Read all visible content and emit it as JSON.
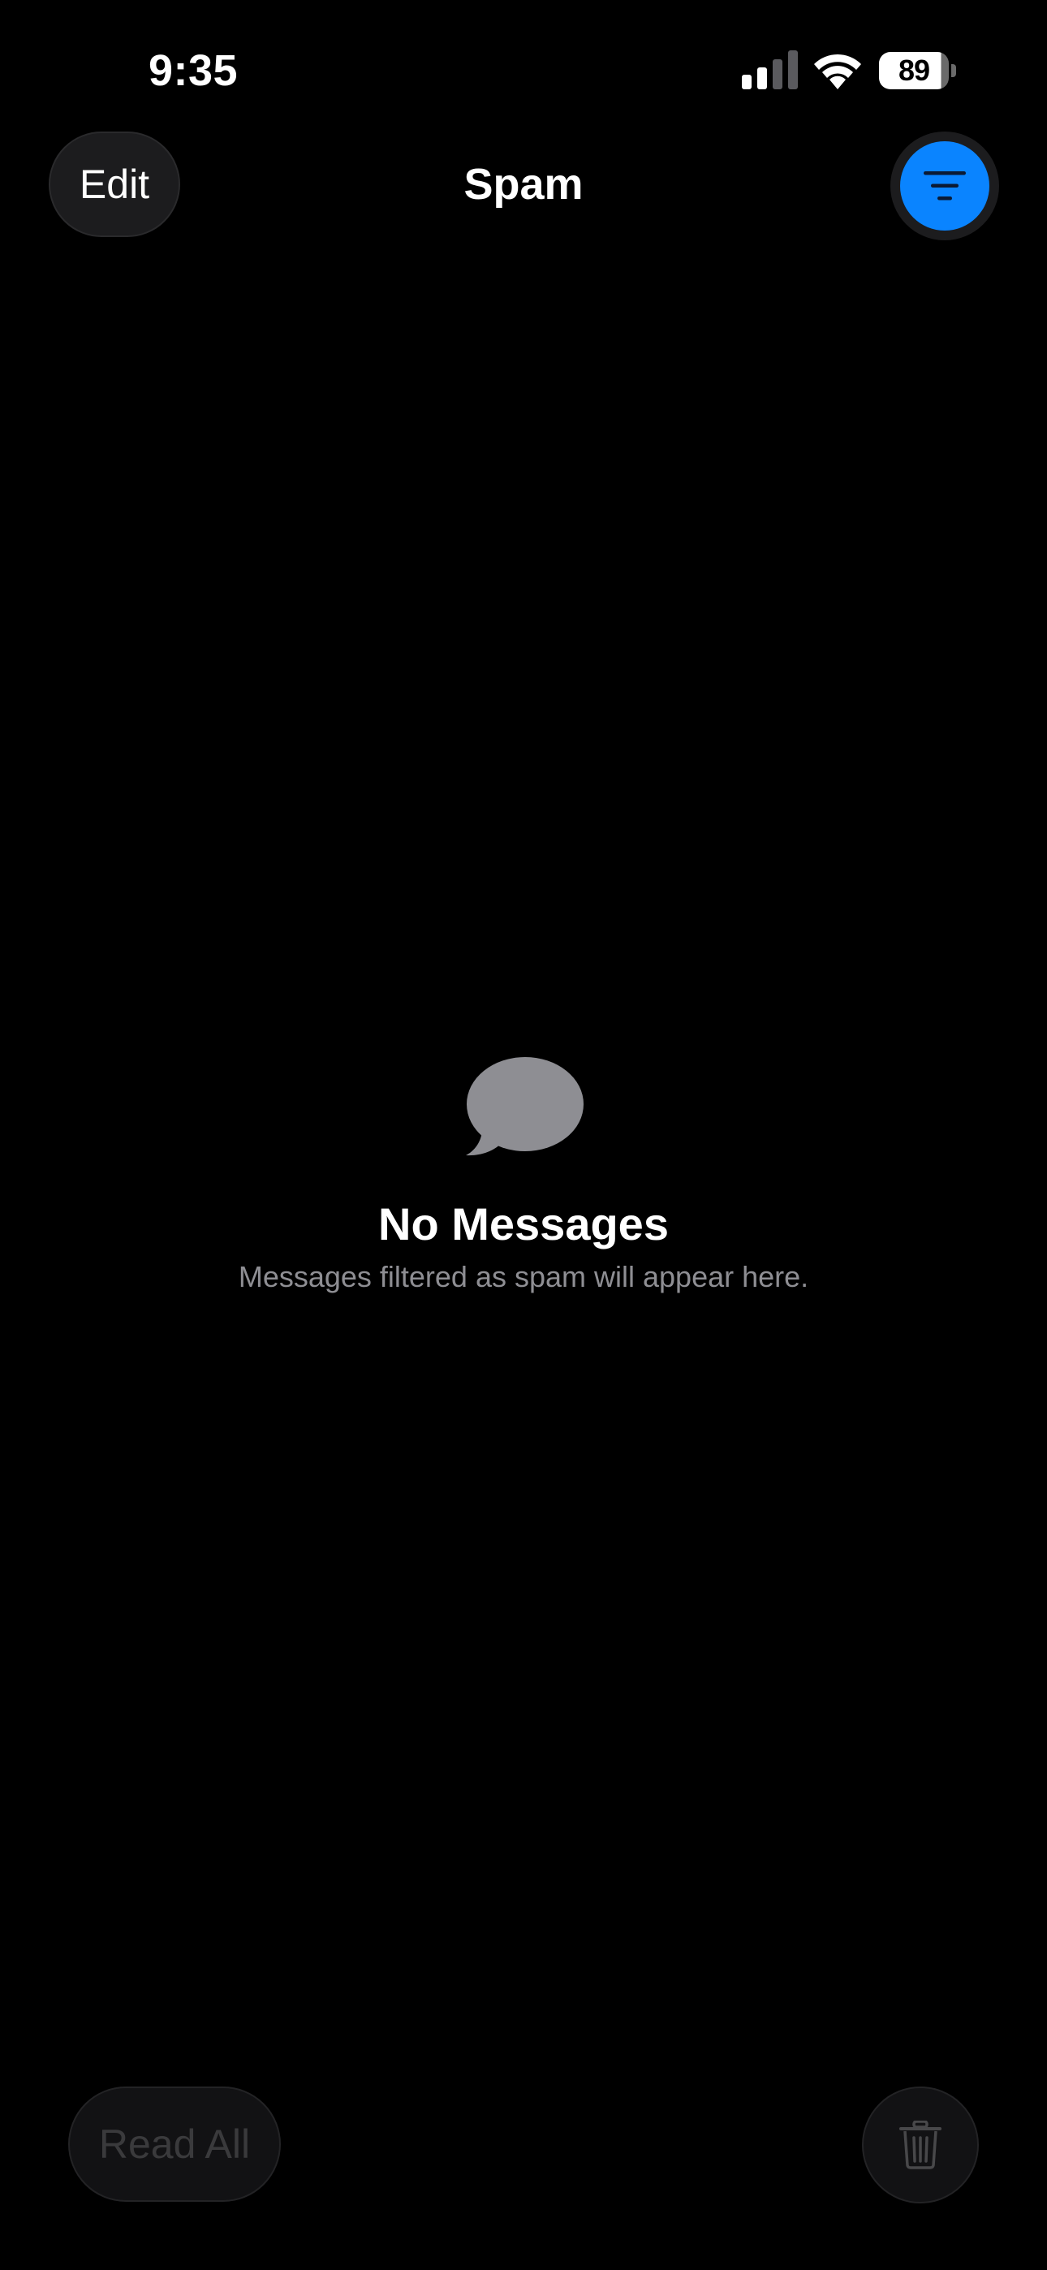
{
  "status_bar": {
    "time": "9:35",
    "battery_level": "89",
    "signal_icon": "cellular-signal-icon",
    "wifi_icon": "wifi-icon",
    "battery_icon": "battery-icon"
  },
  "nav": {
    "edit_label": "Edit",
    "title": "Spam",
    "filter_icon": "filter-icon"
  },
  "empty_state": {
    "icon": "message-bubble-icon",
    "title": "No Messages",
    "subtitle": "Messages filtered as spam will appear here."
  },
  "toolbar": {
    "read_all_label": "Read All",
    "trash_icon": "trash-icon"
  },
  "colors": {
    "background": "#000000",
    "accent": "#0a84ff",
    "secondary_text": "#8e8e93",
    "disabled_text": "#3a3a3c"
  }
}
